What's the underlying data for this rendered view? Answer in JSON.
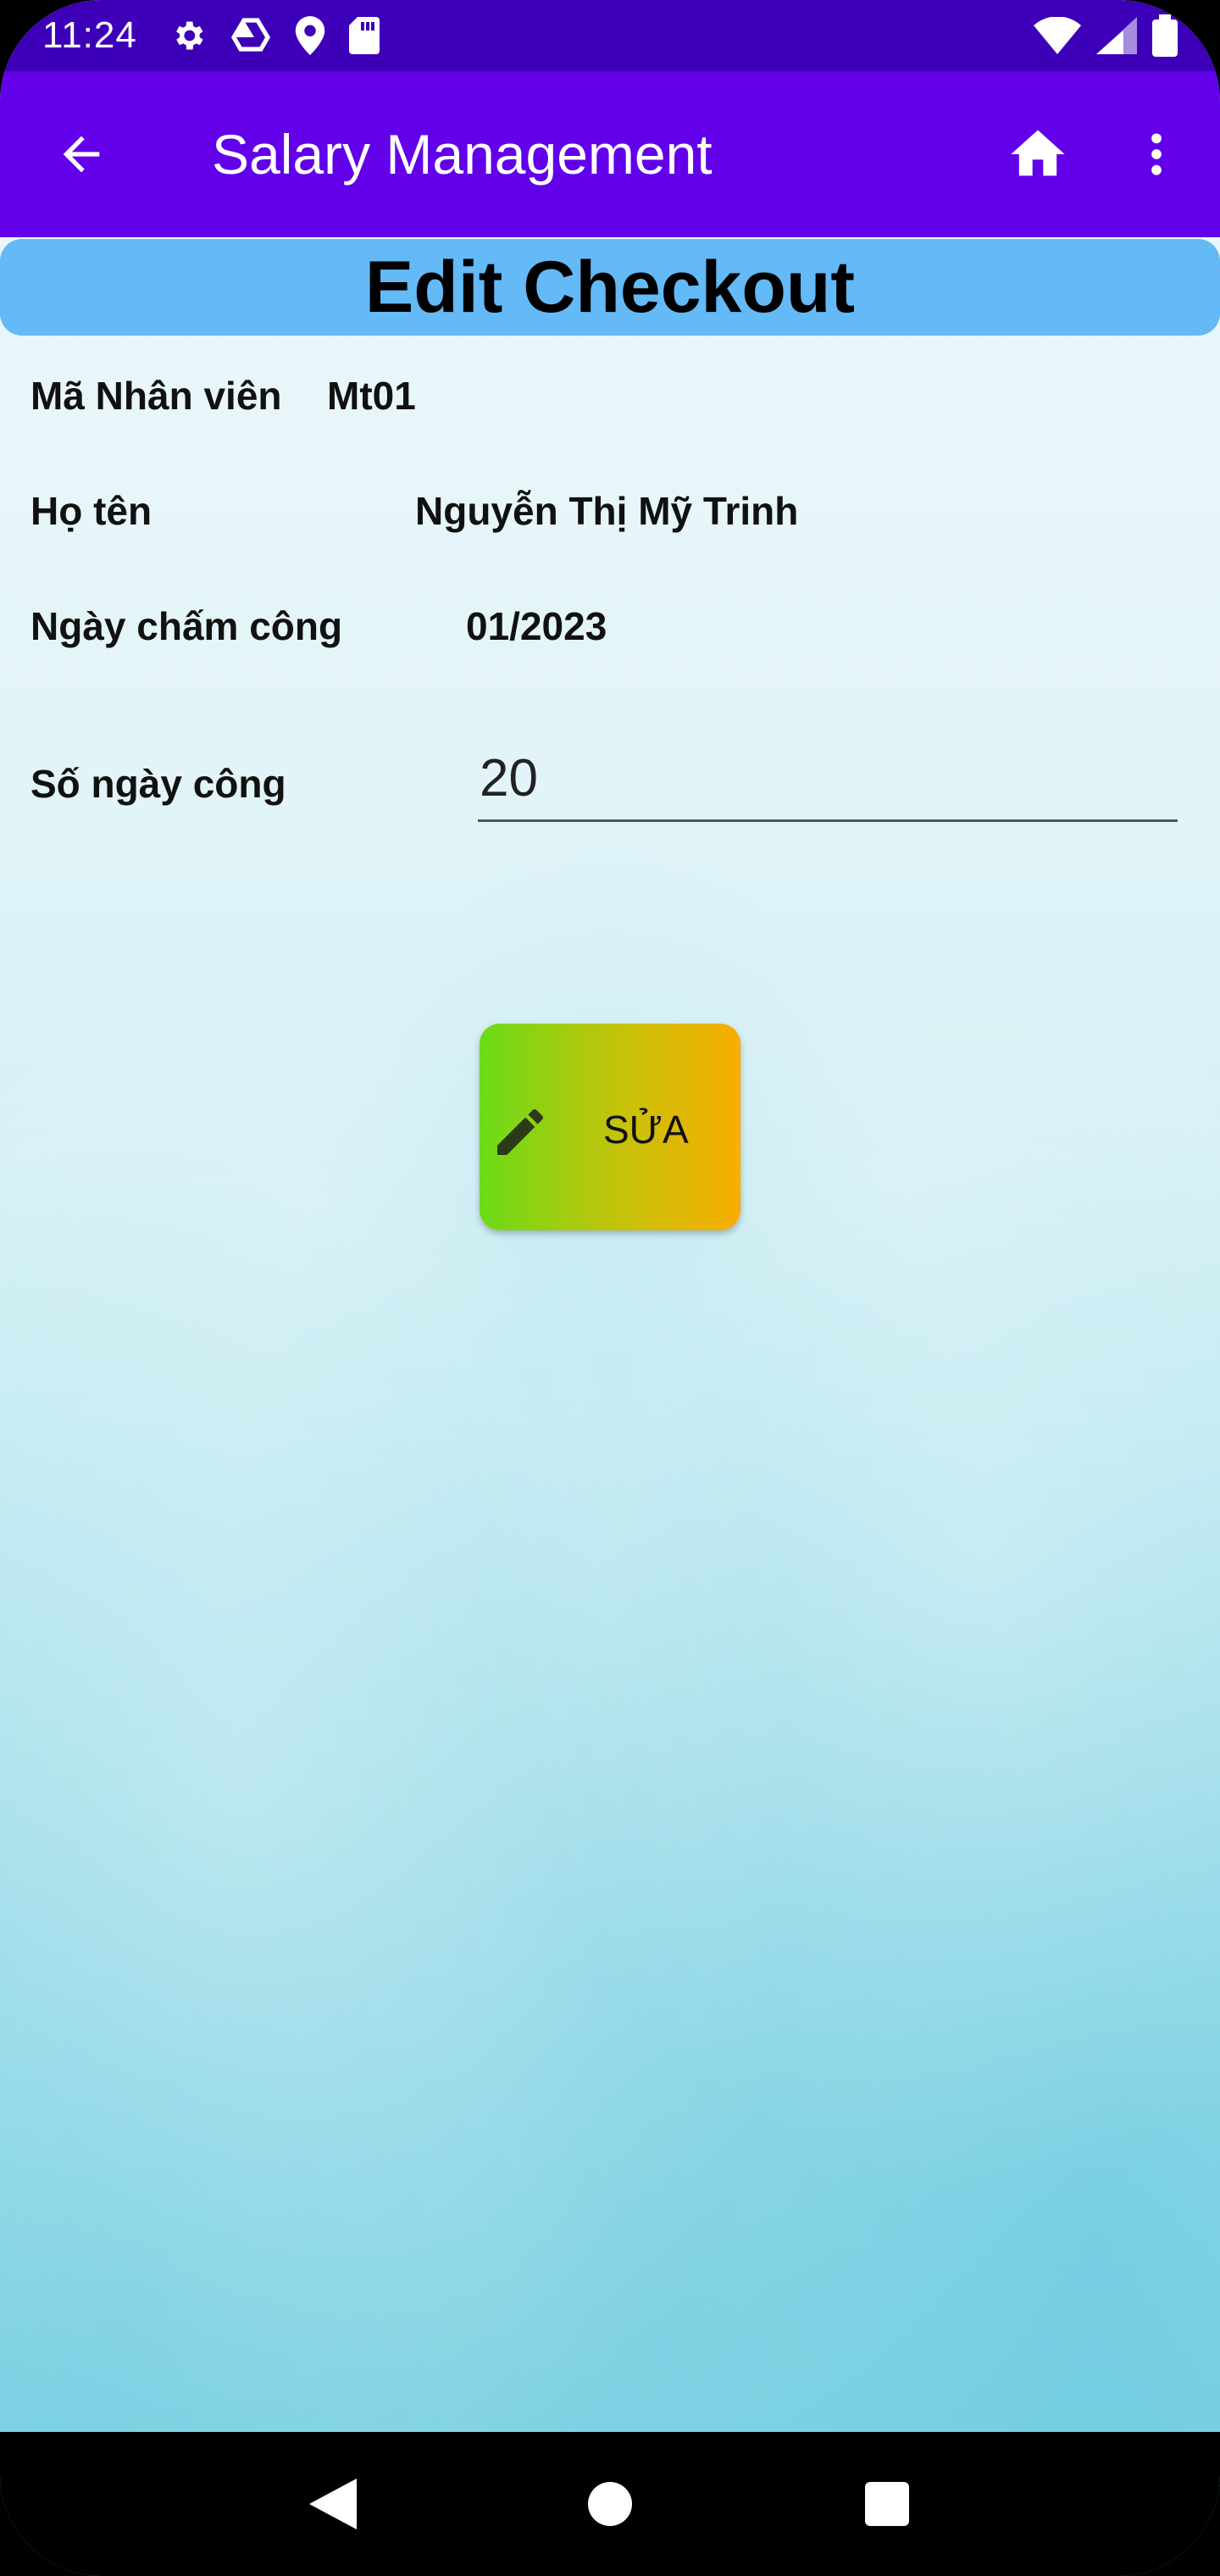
{
  "status_bar": {
    "time": "11:24",
    "left_icons": [
      "gear-icon",
      "drive-icon",
      "location-icon",
      "sd-card-icon"
    ],
    "right_icons": [
      "wifi-icon",
      "signal-icon",
      "battery-icon"
    ]
  },
  "app_bar": {
    "title": "Salary Management",
    "back_icon": "arrow-back-icon",
    "home_icon": "home-icon",
    "menu_icon": "more-vert-icon",
    "color": "#6200ea"
  },
  "page": {
    "title": "Edit Checkout",
    "header_color": "#64b9f7"
  },
  "form": {
    "employee_id_label": "Mã Nhân viên",
    "employee_id_value": "Mt01",
    "name_label": "Họ tên",
    "name_value": "Nguyễn Thị Mỹ Trinh",
    "date_label": "Ngày chấm công",
    "date_value": "01/2023",
    "workdays_label": "Số ngày công",
    "workdays_value": "20"
  },
  "actions": {
    "edit_label": "SỬA",
    "edit_icon": "pencil-icon"
  },
  "nav_bar": {
    "icons": [
      "nav-back-icon",
      "nav-home-icon",
      "nav-recents-icon"
    ]
  }
}
